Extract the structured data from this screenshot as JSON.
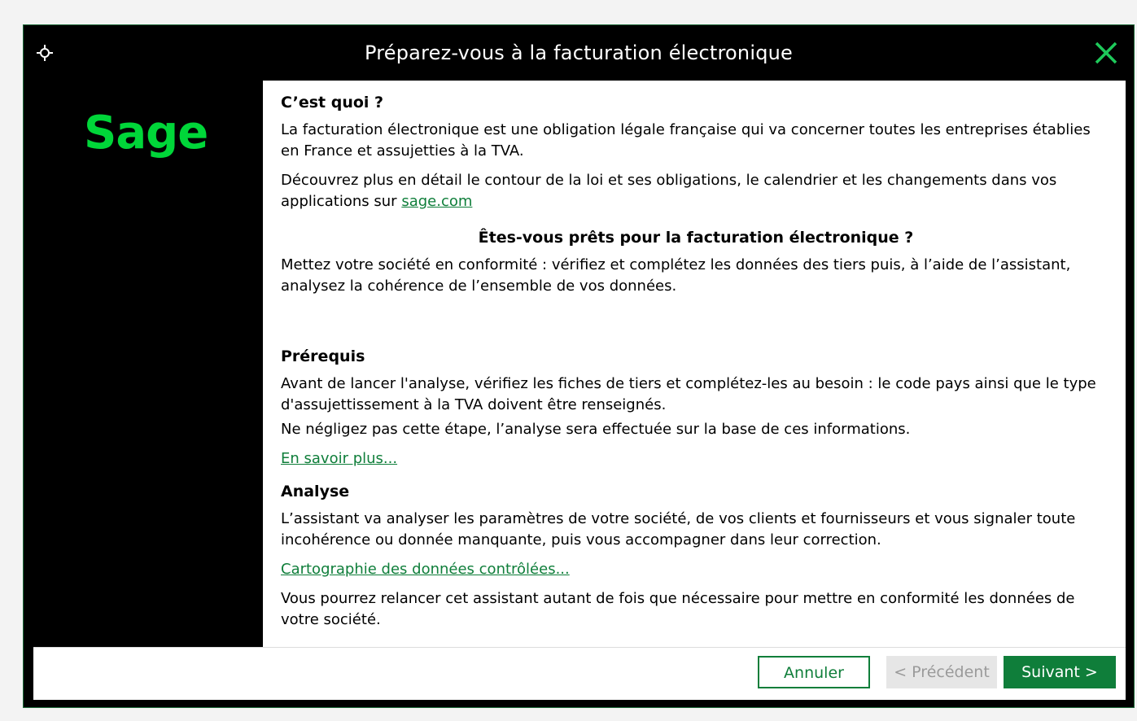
{
  "window": {
    "title": "Préparez-vous à la facturation électronique",
    "title_icon": "settings-icon",
    "close_icon": "close-icon",
    "accent_color": "#0f7e3a",
    "logo_color": "#00d639"
  },
  "sidebar": {
    "logo_text": "Sage"
  },
  "content": {
    "section1": {
      "heading": "C’est quoi ?",
      "p1": "La facturation électronique est une obligation légale française qui va concerner toutes les entreprises établies en France et assujetties à la TVA.",
      "p2_prefix": "Découvrez plus en détail le contour de la loi et ses obligations, le calendrier et les changements dans vos applications sur ",
      "p2_link": "sage.com"
    },
    "section2": {
      "heading": "Êtes-vous prêts pour la facturation électronique ?",
      "p1": "Mettez votre société en conformité : vérifiez et complétez les données des tiers puis, à l’aide de l’assistant, analysez la cohérence de l’ensemble de vos données."
    },
    "section3": {
      "heading": "Prérequis",
      "p1": "Avant de lancer l'analyse, vérifiez les fiches de tiers et complétez-les au besoin : le code pays ainsi que le type d'assujettissement à la TVA doivent être renseignés.",
      "p2": "Ne négligez pas cette étape, l’analyse sera effectuée sur la base de ces informations.",
      "link": "En savoir plus..."
    },
    "section4": {
      "heading": "Analyse",
      "p1": "L’assistant va analyser les paramètres de votre société, de vos clients et fournisseurs et vous signaler toute incohérence ou donnée manquante, puis vous accompagner dans leur correction.",
      "link": "Cartographie des données contrôlées...",
      "p2": "Vous pourrez relancer cet assistant autant de fois que nécessaire pour mettre en conformité les données de votre société."
    }
  },
  "footer": {
    "cancel_label": "Annuler",
    "prev_label": "< Précédent",
    "next_label": "Suivant >"
  }
}
